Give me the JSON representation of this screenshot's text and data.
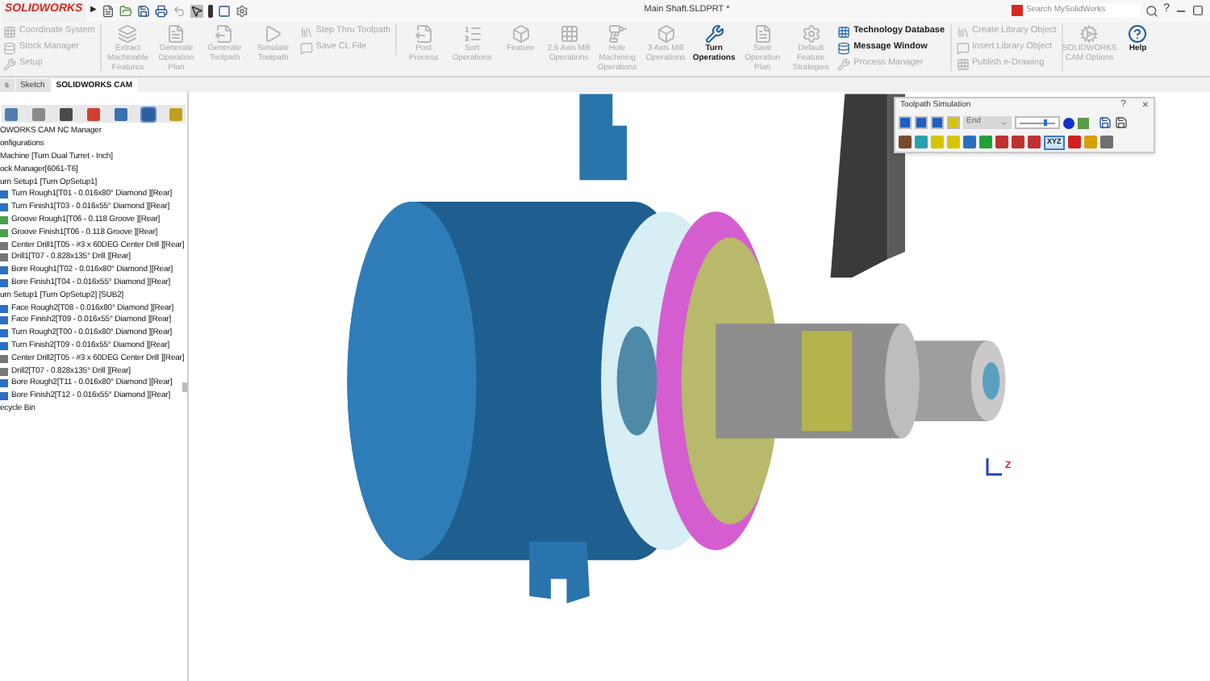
{
  "app": {
    "logo": "SOLIDWORKS",
    "expand_arrow": "▶",
    "title": "Main Shaft.SLDPRT *",
    "search": {
      "placeholder": "Search MySolidWorks"
    },
    "help": "?"
  },
  "ribbon": [
    {
      "kind": "stack",
      "items": [
        {
          "label": "Coordinate System",
          "disabled": true
        },
        {
          "label": "Stock Manager",
          "disabled": true
        },
        {
          "label": "Setup",
          "disabled": true
        }
      ]
    },
    {
      "kind": "large",
      "label": "Extract Machinable Features",
      "disabled": true
    },
    {
      "kind": "large",
      "label": "Generate Operation Plan",
      "disabled": true
    },
    {
      "kind": "large",
      "label": "Generate Toolpath",
      "disabled": true
    },
    {
      "kind": "large",
      "label": "Simulate Toolpath",
      "disabled": true
    },
    {
      "kind": "stack",
      "items": [
        {
          "label": "Step Thru Toolpath",
          "disabled": true
        },
        {
          "label": "Save CL File",
          "disabled": true
        }
      ]
    },
    {
      "kind": "large",
      "label": "Post Process",
      "disabled": true
    },
    {
      "kind": "large",
      "label": "Sort Operations",
      "disabled": true
    },
    {
      "kind": "large",
      "label": "Feature",
      "disabled": true
    },
    {
      "kind": "large",
      "label": "2.5 Axis Mill Operations",
      "disabled": true
    },
    {
      "kind": "large",
      "label": "Hole Machining Operations",
      "disabled": true
    },
    {
      "kind": "large",
      "label": "3 Axis Mill Operations",
      "disabled": true
    },
    {
      "kind": "large",
      "label": "Turn Operations",
      "disabled": false
    },
    {
      "kind": "large",
      "label": "Save Operation Plan",
      "disabled": true
    },
    {
      "kind": "large",
      "label": "Default Feature Strategies",
      "disabled": true
    },
    {
      "kind": "stack",
      "items": [
        {
          "label": "Technology Database",
          "disabled": false
        },
        {
          "label": "Message Window",
          "disabled": false
        },
        {
          "label": "Process Manager",
          "disabled": true
        }
      ]
    },
    {
      "kind": "stack",
      "items": [
        {
          "label": "Create Library Object",
          "disabled": true
        },
        {
          "label": "Insert Library Object",
          "disabled": true
        },
        {
          "label": "Publish e-Drawing",
          "disabled": true
        }
      ]
    },
    {
      "kind": "large",
      "label": "SOLIDWORKS CAM Options",
      "disabled": true
    },
    {
      "kind": "large",
      "label": "Help",
      "disabled": false
    }
  ],
  "tabs": [
    {
      "label": "s",
      "selected": false
    },
    {
      "label": "Sketch",
      "selected": false
    },
    {
      "label": "SOLIDWORKS CAM",
      "selected": true
    }
  ],
  "tree": [
    {
      "label": "OWORKS CAM NC Manager"
    },
    {
      "label": "onfigurations"
    },
    {
      "label": "Machine [Turn Dual Turret - Inch]"
    },
    {
      "label": "ock Manager[6061-T6]"
    },
    {
      "label": "urn Setup1 [Turn OpSetup1]",
      "children": [
        {
          "label": "Turn Rough1[T01 - 0.016x80° Diamond ][Rear]",
          "kind": "turn"
        },
        {
          "label": "Turn Finish1[T03 - 0.016x55° Diamond ][Rear]",
          "kind": "turn"
        },
        {
          "label": "Groove Rough1[T06 - 0.118 Groove ][Rear]",
          "kind": "groove"
        },
        {
          "label": "Groove Finish1[T06 - 0.118 Groove ][Rear]",
          "kind": "groove"
        },
        {
          "label": "Center Drill1[T05 - #3 x 60DEG Center Drill ][Rear]",
          "kind": "drill"
        },
        {
          "label": "Drill1[T07 - 0.828x135° Drill ][Rear]",
          "kind": "drill"
        },
        {
          "label": "Bore Rough1[T02 - 0.016x80° Diamond ][Rear]",
          "kind": "turn"
        },
        {
          "label": "Bore Finish1[T04 - 0.016x55° Diamond ][Rear]",
          "kind": "turn"
        }
      ]
    },
    {
      "label": "urn Setup1 [Turn OpSetup2] [SUB2]",
      "children": [
        {
          "label": "Face Rough2[T08 - 0.016x80° Diamond ][Rear]",
          "kind": "turn"
        },
        {
          "label": "Face Finish2[T09 - 0.016x55° Diamond ][Rear]",
          "kind": "turn"
        },
        {
          "label": "Turn Rough2[T00 - 0.016x80° Diamond ][Rear]",
          "kind": "turn"
        },
        {
          "label": "Turn Finish2[T09 - 0.016x55° Diamond ][Rear]",
          "kind": "turn"
        },
        {
          "label": "Center Drill2[T05 - #3 x 60DEG Center Drill ][Rear]",
          "kind": "drill"
        },
        {
          "label": "Drill2[T07 - 0.828x135° Drill ][Rear]",
          "kind": "drill"
        },
        {
          "label": "Bore Rough2[T11 - 0.016x80° Diamond ][Rear]",
          "kind": "turn"
        },
        {
          "label": "Bore Finish2[T12 - 0.016x55° Diamond ][Rear]",
          "kind": "turn"
        }
      ]
    },
    {
      "label": "ecycle Bin"
    }
  ],
  "simulation": {
    "title": "Toolpath Simulation",
    "help": "?",
    "close": "×",
    "mode": "End",
    "speed": {
      "level": 0.7
    },
    "view_button": {
      "label": "XYZ",
      "selected": true
    }
  },
  "triad": {
    "axis": "Z"
  }
}
